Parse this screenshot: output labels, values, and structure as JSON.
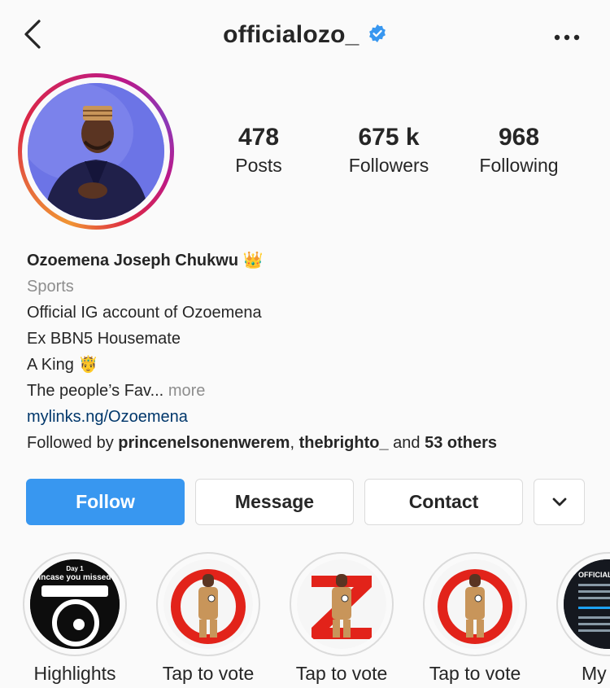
{
  "header": {
    "username": "officialozo_"
  },
  "stats": [
    {
      "value": "478",
      "label": "Posts"
    },
    {
      "value": "675 k",
      "label": "Followers"
    },
    {
      "value": "968",
      "label": "Following"
    }
  ],
  "bio": {
    "name": "Ozoemena Joseph Chukwu",
    "name_emoji": "👑",
    "category": "Sports",
    "line1": "Official IG account of Ozoemena",
    "line2": "Ex BBN5 Housemate",
    "line3": "A King",
    "line3_emoji": "🤴",
    "line4": "The people’s Fav...",
    "more": "more",
    "link": "mylinks.ng/Ozoemena",
    "followed_by_prefix": "Followed by",
    "followed_user1": "princenelsonenwerem",
    "followed_user2": "thebrighto_",
    "followed_and": "and",
    "followed_others": "53 others"
  },
  "buttons": {
    "follow": "Follow",
    "message": "Message",
    "contact": "Contact"
  },
  "highlights": [
    {
      "label": "Highlights",
      "overlay_text": "Day 1",
      "overlay_text2": "incase you missed"
    },
    {
      "label": "Tap to vote"
    },
    {
      "label": "Tap to vote"
    },
    {
      "label": "Tap to vote"
    },
    {
      "label": "My Tw",
      "overlay_text": "OFFICIAL OZOE"
    }
  ],
  "colors": {
    "accent": "#3897f0",
    "link": "#00376b",
    "verified": "#3897f0",
    "secondary_text": "#8e8e8e",
    "vote_red": "#e2231a"
  }
}
